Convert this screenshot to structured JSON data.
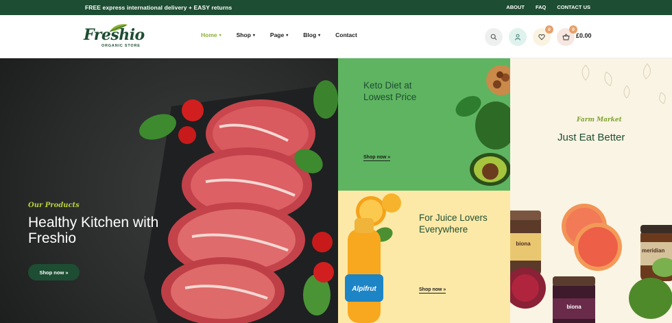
{
  "topbar": {
    "promo": "FREE express international delivery + EASY returns",
    "links": [
      "ABOUT",
      "FAQ",
      "CONTACT US"
    ]
  },
  "logo": {
    "name": "Freshio",
    "tagline": "ORGANIC STORE"
  },
  "nav": {
    "items": [
      {
        "label": "Home",
        "dropdown": true,
        "active": true
      },
      {
        "label": "Shop",
        "dropdown": true
      },
      {
        "label": "Page",
        "dropdown": true
      },
      {
        "label": "Blog",
        "dropdown": true
      },
      {
        "label": "Contact",
        "dropdown": false
      }
    ]
  },
  "header_icons": {
    "wishlist_count": "0",
    "cart_count": "0",
    "cart_total": "£0.00"
  },
  "hero": {
    "subtitle": "Our Products",
    "title": "Healthy Kitchen with Freshio",
    "button": "Shop now »"
  },
  "tiles": {
    "keto": {
      "title": "Keto Diet at Lowest Price",
      "link": "Shop now »"
    },
    "juice": {
      "title": "For Juice Lovers Everywhere",
      "link": "Shop now »",
      "bottle_label": "Alpifrut"
    },
    "farm": {
      "subtitle": "Farm Market",
      "title": "Just Eat Better",
      "jar_labels": [
        "biona",
        "meridian",
        "biona"
      ]
    }
  },
  "colors": {
    "brand_green": "#1d4d32",
    "accent_lime": "#8ab133",
    "keto_bg": "#5fb461",
    "juice_bg": "#fde9a7",
    "farm_bg": "#faf4e4"
  }
}
